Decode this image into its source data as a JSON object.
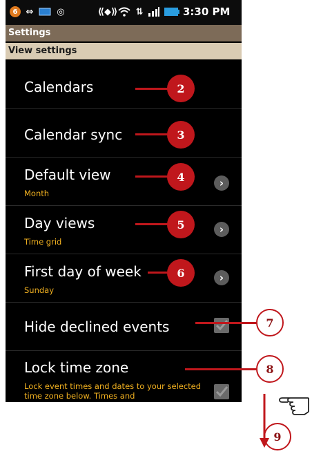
{
  "statusbar": {
    "time": "3:30 PM",
    "notification_badge": "6",
    "icons": [
      "notification-badge-icon",
      "usb-icon",
      "card-icon",
      "sync-icon",
      "vibrate-icon",
      "wifi-icon",
      "data-icon",
      "signal-icon",
      "battery-icon"
    ]
  },
  "appbar": {
    "title": "Settings"
  },
  "section": {
    "title": "View settings"
  },
  "rows": [
    {
      "title": "Calendars"
    },
    {
      "title": "Calendar sync"
    },
    {
      "title": "Default view",
      "subtitle": "Month",
      "chevron": true
    },
    {
      "title": "Day views",
      "subtitle": "Time grid",
      "chevron": true
    },
    {
      "title": "First day of week",
      "subtitle": "Sunday",
      "chevron": true
    },
    {
      "title": "Hide declined events",
      "checked": true
    },
    {
      "title": "Lock time zone",
      "description": "Lock event times and dates to your selected time zone below. Times and",
      "checked": true
    }
  ],
  "chevron_glyph": "›",
  "callouts": [
    "2",
    "3",
    "4",
    "5",
    "6",
    "7",
    "8",
    "9"
  ],
  "colors": {
    "accent_red": "#c0171c",
    "appbar": "#7d6b58",
    "section": "#d9cbb3",
    "subtitle": "#f0b020"
  }
}
